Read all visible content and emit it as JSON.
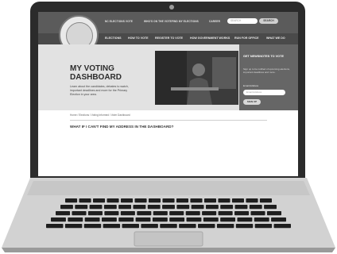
{
  "top_links": [
    "NC ELECTIONS VOTE",
    "WHO'S ON THE VOTE",
    "FIND MY ELECTIONS",
    "CAREER"
  ],
  "search": {
    "placeholder": "SEARCH",
    "button": "SEARCH"
  },
  "nav": [
    "ELECTIONS",
    "HOW TO VOTE",
    "REGISTER TO VOTE",
    "HOW GOVERNMENT WORKS",
    "RUN FOR OFFICE",
    "WHAT WE DO"
  ],
  "hero": {
    "title": "MY VOTING DASHBOARD",
    "intro": "Learn about the candidates, debates to watch, important deadlines and more for the Primary Election in your area."
  },
  "newsletter": {
    "title": "GET NEWSNOTES TO VOTE",
    "text": "Sign up to be notified of upcoming elections, important deadlines and more.",
    "email_label": "Email Address",
    "email_placeholder": "Email Address",
    "button": "SIGN UP"
  },
  "breadcrumb": "Home / Elections / Voting Informed / Voter Dashboard",
  "faq_heading": "WHAT IF I CAN'T FIND MY ADDRESS IN THE DASHBOARD?"
}
